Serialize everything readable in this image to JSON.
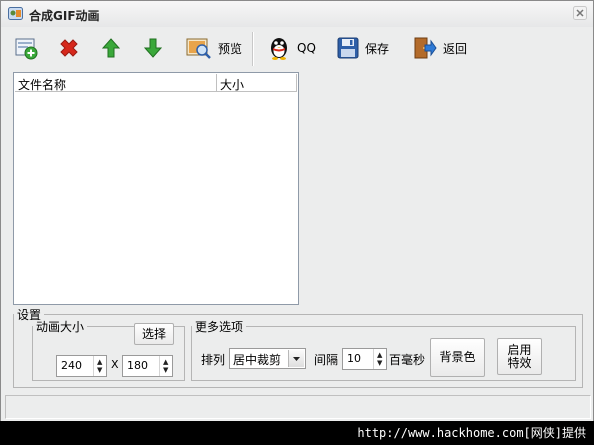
{
  "window": {
    "title": "合成GIF动画"
  },
  "toolbar": {
    "preview_label": "预览",
    "qq_label": "QQ",
    "save_label": "保存",
    "back_label": "返回"
  },
  "file_list": {
    "columns": [
      "文件名称",
      "大小"
    ],
    "rows": []
  },
  "settings": {
    "legend": "设置",
    "animation_size": {
      "legend": "动画大小",
      "select_label": "选择",
      "width": "240",
      "separator": "X",
      "height": "180"
    },
    "more_options": {
      "legend": "更多选项",
      "arrange_label": "排列",
      "arrange_value": "居中裁剪",
      "interval_label": "间隔",
      "interval_value": "10",
      "interval_unit": "百毫秒",
      "bgcolor_label": "背景色",
      "effects_label": "启用\n特效"
    }
  },
  "watermark": "http://www.hackhome.com[网侠]提供",
  "icons": {
    "add": "add-icon",
    "delete": "delete-icon",
    "up": "arrow-up-icon",
    "down": "arrow-down-icon",
    "preview": "preview-icon",
    "qq": "qq-penguin-icon",
    "save": "floppy-icon",
    "back": "exit-door-icon"
  },
  "colors": {
    "red": "#d6281c",
    "green": "#3aa83a",
    "blue": "#2e5fa8"
  }
}
